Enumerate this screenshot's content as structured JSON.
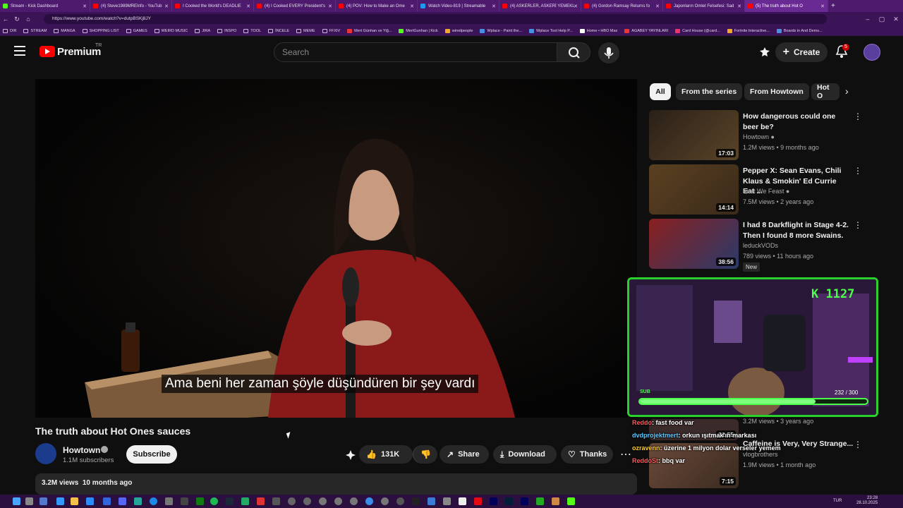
{
  "browser": {
    "tabs": [
      {
        "label": "Stream - Kick Dashboard",
        "color": "#53fc18"
      },
      {
        "label": "(4) Steve1989MREInfo - YouTub",
        "color": "#ff0000"
      },
      {
        "label": "I Cooked the World's DEADLIE",
        "color": "#ff0000"
      },
      {
        "label": "(4) I Cooked EVERY President's",
        "color": "#ff0000"
      },
      {
        "label": "(4) POV: How to Make an Ome",
        "color": "#ff0000"
      },
      {
        "label": "Watch Video-819 | Streamable",
        "color": "#1d9bf0"
      },
      {
        "label": "(4) ASKERLER, ASKERİ YEMEKL",
        "color": "#ff0000"
      },
      {
        "label": "(4) Gordon Ramsay Returns fo",
        "color": "#ff0000"
      },
      {
        "label": "Japonların Omlet Felsefesi: Sad",
        "color": "#ff0000"
      },
      {
        "label": "(5) The truth about Hot O",
        "color": "#ff0000"
      }
    ],
    "url": "https://www.youtube.com/watch?v=dutpBSKj8JY",
    "bookmarks": [
      "DIR",
      "STREAM",
      "MANGA",
      "SHOPPING LIST",
      "GAMES",
      "WEIRD MUSIC",
      "JIRA",
      "INSPO",
      "TOOL",
      "İNCELE",
      "MEME",
      "FFXIV",
      "Mert Günhan ve Yiğ...",
      "MertGunhan | Kick",
      "wiredpeople",
      "Wplace - Paint the...",
      "Wplace Tool Help P...",
      "Home • HBO Max",
      "AGABEY YAYINLARI",
      "Card House (@card...",
      "Fortnite Interactive...",
      "Boards in And Dems..."
    ]
  },
  "header": {
    "logo_text": "Premium",
    "logo_sup": "TR",
    "search_placeholder": "Search",
    "create_label": "Create",
    "notification_count": "5"
  },
  "video": {
    "subtitle": "Ama beni her zaman şöyle düşündüren bir şey vardı",
    "title": "The truth about Hot Ones sauces",
    "channel": "Howtown",
    "subscribers": "1.1M subscribers",
    "subscribe_label": "Subscribe",
    "likes": "131K",
    "share_label": "Share",
    "download_label": "Download",
    "thanks_label": "Thanks",
    "views": "3.2M views",
    "age": "10 months ago"
  },
  "chips": [
    "All",
    "From the series",
    "From Howtown",
    "Hot O"
  ],
  "recommendations": [
    {
      "title": "How dangerous could one beer be?",
      "channel": "Howtown",
      "meta": "1.2M views • 9 months ago",
      "duration": "17:03",
      "thumb": "#3a2a18",
      "verified": true
    },
    {
      "title": "Pepper X: Sean Evans, Chili Klaus & Smokin' Ed Currie Eat ...",
      "channel": "First We Feast",
      "meta": "7.5M views • 2 years ago",
      "duration": "14:14",
      "thumb": "#4a3320",
      "verified": true
    },
    {
      "title": "I had 8 Darkflight in Stage 4-2. Then I found 8 more Swains.",
      "channel": "leduckVODs",
      "meta": "789 views • 11 hours ago",
      "duration": "38:56",
      "thumb": "#7a2020",
      "badge": "New",
      "verified": false
    }
  ],
  "partial_rec": {
    "meta_top": "3.2M views • 3 years ago",
    "title": "Caffeine is Very, Very Strange...",
    "channel": "vlogbrothers",
    "meta": "1.9M views • 1 month ago",
    "duration_top": "31:55",
    "duration": "7:15"
  },
  "stream_overlay": {
    "viewer_count": "K 1127",
    "sub_label": "SUB",
    "sub_progress": "232 / 300",
    "sub_fraction": 0.773,
    "chat": [
      {
        "user": "Reddo",
        "text": ": fast food var",
        "cls": "u"
      },
      {
        "user": "dvdprojektmert",
        "text": ": orkun ışıtmak'ın markası",
        "cls": "u2"
      },
      {
        "user": "ozravenn",
        "text": ": üzerine 1 milyon dolar verseler yemem",
        "cls": "u3"
      },
      {
        "user": "ReddoSt",
        "text": ": bbq var",
        "cls": "u"
      }
    ]
  },
  "taskbar": {
    "lang": "TUR",
    "time": "23:28",
    "date": "28.10.2025"
  }
}
